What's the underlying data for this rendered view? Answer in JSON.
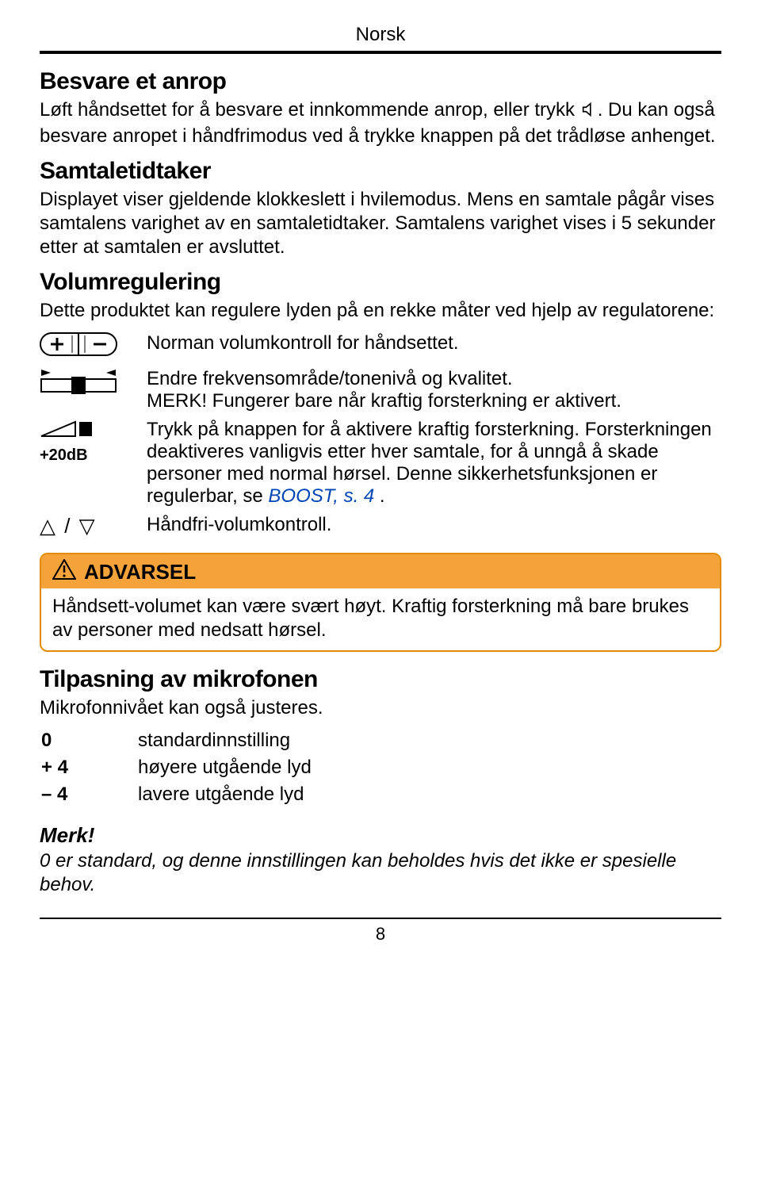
{
  "header": {
    "language": "Norsk"
  },
  "sections": {
    "answer": {
      "title": "Besvare et anrop",
      "p1a": "Løft håndsettet for å besvare et innkommende anrop, eller trykk ",
      "p1b": ". Du kan også besvare anropet i håndfrimodus ved å trykke knappen på det trådløse anhenget."
    },
    "timer": {
      "title": "Samtaletidtaker",
      "body": "Displayet viser gjeldende klokkeslett i hvilemodus. Mens en samtale pågår vises samtalens varighet av en samtaletidtaker. Samtalens varighet vises i 5 sekunder etter at samtalen er avsluttet."
    },
    "volume": {
      "title": "Volumregulering",
      "intro": "Dette produktet kan regulere lyden på en rekke måter ved hjelp av regulatorene:",
      "rows": {
        "r1": "Norman volumkontroll for håndsettet.",
        "r2a": "Endre frekvensområde/tonenivå og kvalitet.",
        "r2b": "MERK! Fungerer bare når kraftig forsterkning er aktivert.",
        "r3a": "Trykk på knappen for å aktivere kraftig forsterkning. Forsterkningen deaktiveres vanligvis etter hver samtale, for å unngå å skade personer med normal hørsel. Denne sikkerhetsfunksjonen er regulerbar, se ",
        "r3link": "BOOST, s. 4",
        "r3b": " .",
        "r4": "Håndfri-volumkontroll.",
        "boost_label": "+20dB"
      }
    },
    "warning": {
      "title": "ADVARSEL",
      "body": "Håndsett-volumet kan være svært høyt. Kraftig forsterkning må bare brukes av personer med nedsatt hørsel."
    },
    "mic": {
      "title": "Tilpasning av mikrofonen",
      "intro": "Mikrofonnivået kan også justeres.",
      "rows": [
        {
          "key": "0",
          "val": "standardinnstilling"
        },
        {
          "key": "+ 4",
          "val": "høyere utgående lyd"
        },
        {
          "key": "– 4",
          "val": "lavere utgående lyd"
        }
      ]
    },
    "note": {
      "title": "Merk!",
      "body": "0 er standard, og denne innstillingen kan beholdes hvis det ikke er spesielle behov."
    }
  },
  "footer": {
    "page": "8"
  }
}
